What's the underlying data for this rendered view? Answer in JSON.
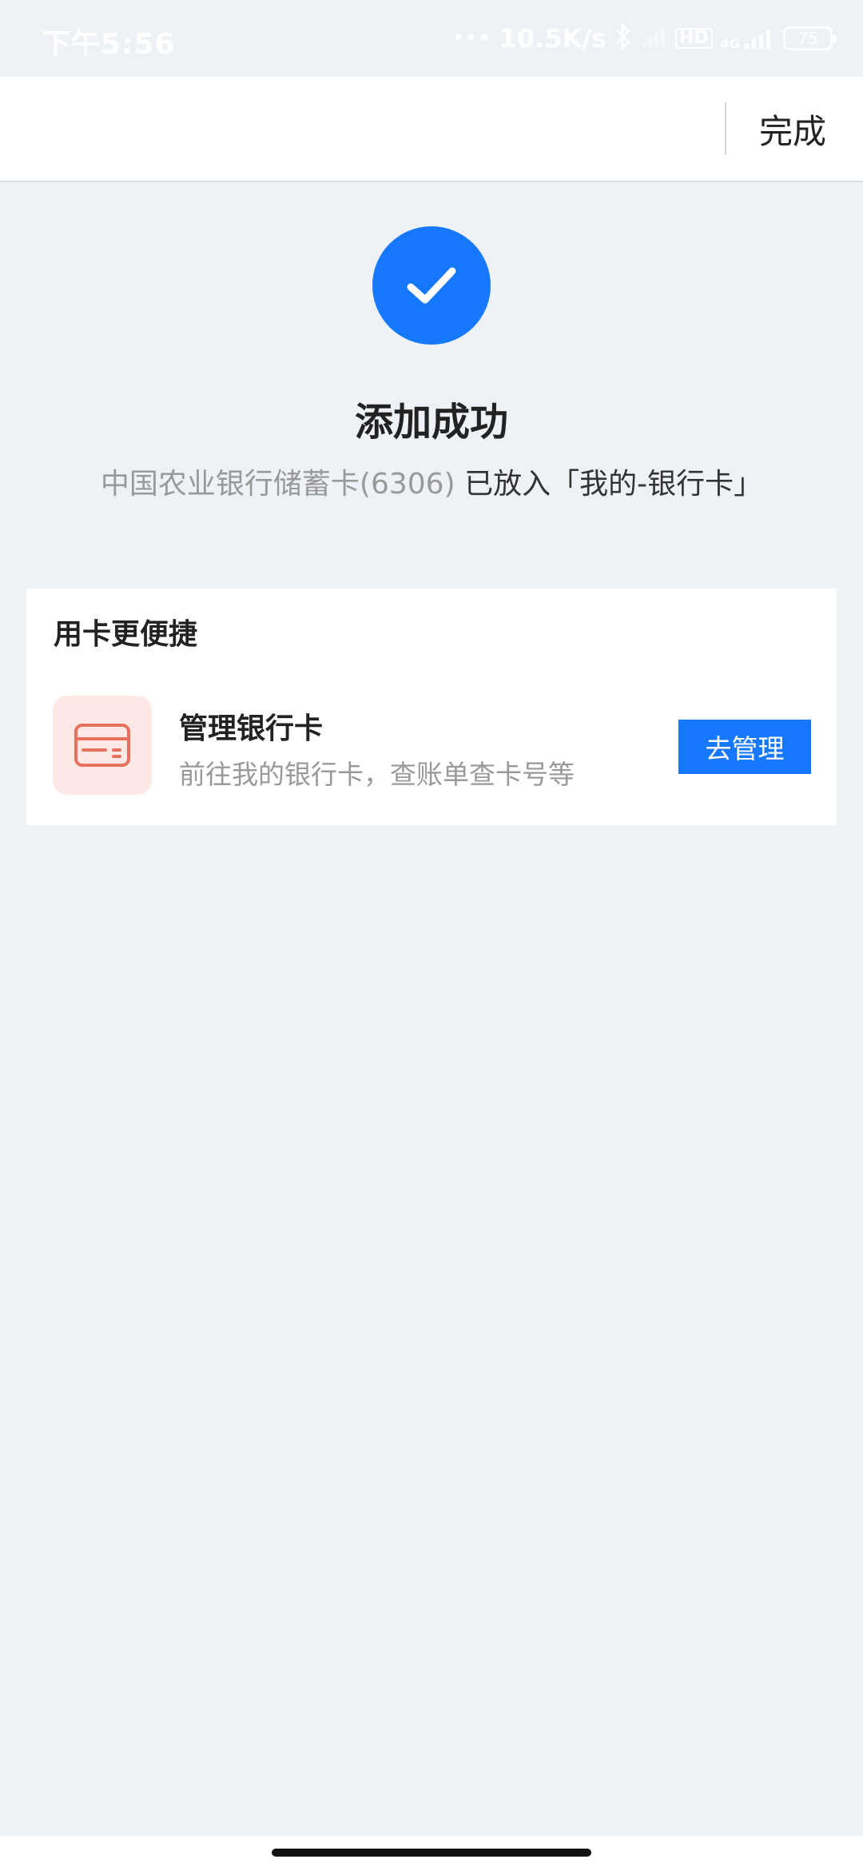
{
  "status_bar": {
    "time": "下午5:56",
    "network_speed": "10.5K/s",
    "hd_label": "HD",
    "network_type": "4G",
    "battery_level": "75",
    "icons": [
      "bluetooth-icon",
      "signal-icon",
      "battery-icon"
    ]
  },
  "header": {
    "done_label": "完成"
  },
  "success": {
    "title": "添加成功",
    "desc_prefix": "中国农业银行储蓄卡(6306)",
    "desc_suffix": " 已放入「我的-银行卡」"
  },
  "card_section": {
    "title": "用卡更便捷",
    "feature": {
      "title": "管理银行卡",
      "desc": "前往我的银行卡，查账单查卡号等",
      "button_label": "去管理",
      "icon": "bank-card-icon"
    }
  },
  "colors": {
    "accent": "#1677ff",
    "background": "#eef1f6",
    "card_icon_bg": "#fde8e5",
    "card_icon_stroke": "#e8705f"
  }
}
